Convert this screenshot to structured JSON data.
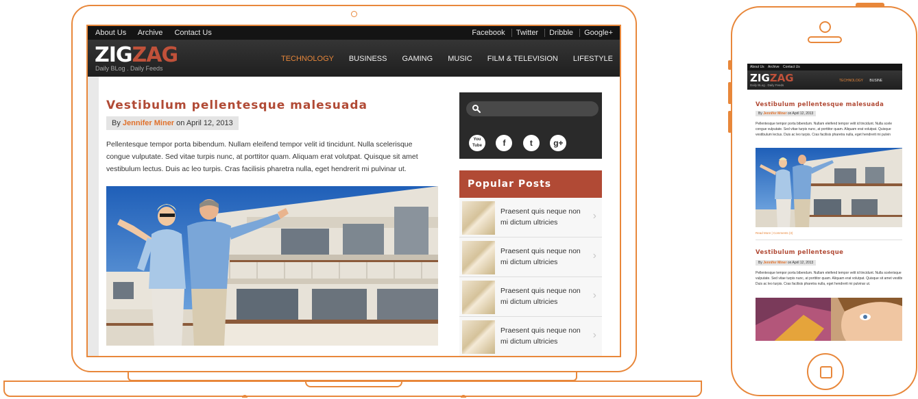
{
  "site": {
    "logo_left": "ZIG",
    "logo_right": "ZAG",
    "tagline": "Daily BLog . Daily Feeds"
  },
  "topbar": {
    "left_links": [
      "About Us",
      "Archive",
      "Contact Us"
    ],
    "right_links": [
      "Facebook",
      "Twitter",
      "Dribble",
      "Google+"
    ]
  },
  "nav": {
    "items": [
      "TECHNOLOGY",
      "BUSINESS",
      "GAMING",
      "MUSIC",
      "FILM & TELEVISION",
      "LIFESTYLE"
    ],
    "active": "TECHNOLOGY"
  },
  "post": {
    "title": "Vestibulum pellentesque malesuada",
    "by": "By",
    "author": "Jennifer Miner",
    "date": "on April 12, 2013",
    "excerpt": "Pellentesque tempor porta bibendum. Nullam eleifend tempor velit id tincidunt. Nulla scelerisque congue vulputate. Sed vitae turpis nunc, at porttitor quam. Aliquam erat volutpat. Quisque sit amet vestibulum lectus. Duis ac leo turpis. Cras facilisis pharetra nulla, eget hendrerit mi pulvinar ut."
  },
  "sidebar": {
    "search_placeholder": "",
    "socials": [
      {
        "name": "youtube-icon",
        "glyph": "You Tube"
      },
      {
        "name": "facebook-icon",
        "glyph": "f"
      },
      {
        "name": "twitter-icon",
        "glyph": "t"
      },
      {
        "name": "googleplus-icon",
        "glyph": "g+"
      }
    ],
    "popular_title": "Popular Posts",
    "popular_items": [
      "Praesent quis neque non mi dictum ultricies",
      "Praesent quis neque non mi dictum ultricies",
      "Praesent quis neque non mi dictum ultricies",
      "Praesent quis neque non mi dictum ultricies"
    ]
  },
  "mobile": {
    "topbar_links": [
      "About Us",
      "Archive",
      "Contact Us"
    ],
    "nav_items": [
      "TECHNOLOGY",
      "BUSINE"
    ],
    "post1": {
      "title": "Vestibulum pellentesque malesuada",
      "by": "By",
      "author": "Jennifer Miner",
      "date": "on April 12, 2013",
      "excerpt_lines": [
        "Pellentesque tempor porta bibendum. Nullam eleifend tempor velit id tincidunt. Nulla scele",
        "congue vulputate. Sed vitae turpis nunc, at porttitor quam. Aliquam erat volutpat. Quisque",
        "vestibulum lectus. Duis ac leo turpis. Cras facilisis pharetra nulla, eget hendrerit mi pulvin"
      ],
      "more": "Read More | Comments (3)"
    },
    "post2": {
      "title": "Vestibulum pellentesque",
      "by": "By",
      "author": "Jennifer Miner",
      "date": "on April 12, 2013",
      "excerpt_lines": [
        "Pellentesque tempor porta bibendum. Nullam eleifend tempor velit id tincidunt. Nulla scelerisque",
        "vulputate. Sed vitae turpis nunc, at porttitor quam. Aliquam erat volutpat. Quisque sit amet vestibu",
        "Duis ac leo turpis. Cras facilisis pharetra nulla, eget hendrerit mi pulvinar ut."
      ]
    }
  },
  "colors": {
    "accent_orange": "#e8873a",
    "brand_red": "#b14a35",
    "dark_bar": "#141414"
  }
}
